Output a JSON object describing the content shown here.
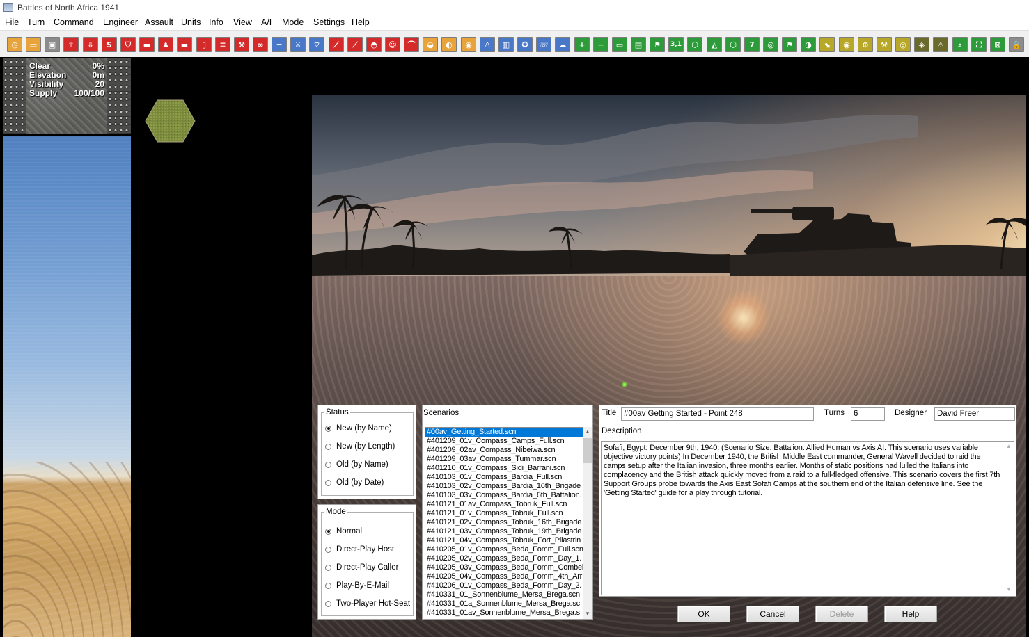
{
  "window": {
    "title": "Battles of North Africa 1941"
  },
  "menu": [
    "File",
    "Turn",
    "Command",
    "Engineer",
    "Assault",
    "Units",
    "Info",
    "View",
    "A/I",
    "Mode",
    "Settings",
    "Help"
  ],
  "toolbar": {
    "buttons": [
      {
        "icon": "clock-icon",
        "color": "#e8a33a",
        "glyph": "◷"
      },
      {
        "icon": "screen-icon",
        "color": "#e8a33a",
        "glyph": "▭"
      },
      {
        "icon": "save-disk-icon",
        "color": "#8c8c8c",
        "glyph": "▣"
      },
      {
        "icon": "upload-icon",
        "color": "#d42a2a",
        "glyph": "⇧"
      },
      {
        "icon": "download-icon",
        "color": "#d42a2a",
        "glyph": "⇩"
      },
      {
        "icon": "s-icon",
        "color": "#d42a2a",
        "glyph": "S"
      },
      {
        "icon": "shield-icon",
        "color": "#d42a2a",
        "glyph": "⛉"
      },
      {
        "icon": "tank-icon",
        "color": "#d42a2a",
        "glyph": "▬"
      },
      {
        "icon": "infantry-icon",
        "color": "#d42a2a",
        "glyph": "♟"
      },
      {
        "icon": "truck-icon",
        "color": "#d42a2a",
        "glyph": "▬"
      },
      {
        "icon": "door-icon",
        "color": "#d42a2a",
        "glyph": "▯"
      },
      {
        "icon": "list-icon",
        "color": "#d42a2a",
        "glyph": "≡"
      },
      {
        "icon": "wrench-icon",
        "color": "#d42a2a",
        "glyph": "⚒"
      },
      {
        "icon": "binoculars-icon",
        "color": "#d42a2a",
        "glyph": "∞"
      },
      {
        "icon": "rifle-icon",
        "color": "#4a78c8",
        "glyph": "━"
      },
      {
        "icon": "crossed-swords-icon",
        "color": "#4a78c8",
        "glyph": "⚔"
      },
      {
        "icon": "signal-icon",
        "color": "#4a78c8",
        "glyph": "⌔"
      },
      {
        "icon": "artillery-icon",
        "color": "#d42a2a",
        "glyph": "⟋"
      },
      {
        "icon": "cannon-icon",
        "color": "#d42a2a",
        "glyph": "⟋"
      },
      {
        "icon": "helmet-icon",
        "color": "#d42a2a",
        "glyph": "◓"
      },
      {
        "icon": "face-icon",
        "color": "#d42a2a",
        "glyph": "☺"
      },
      {
        "icon": "bridge-icon",
        "color": "#d42a2a",
        "glyph": "⌒"
      },
      {
        "icon": "gauge-icon",
        "color": "#e8a33a",
        "glyph": "◒"
      },
      {
        "icon": "mine-icon",
        "color": "#e8a33a",
        "glyph": "◐"
      },
      {
        "icon": "ration-icon",
        "color": "#e8a33a",
        "glyph": "◉"
      },
      {
        "icon": "soldier-icon",
        "color": "#4a78c8",
        "glyph": "♙"
      },
      {
        "icon": "book-icon",
        "color": "#4a78c8",
        "glyph": "▥"
      },
      {
        "icon": "medal-icon",
        "color": "#4a78c8",
        "glyph": "✪"
      },
      {
        "icon": "phone-icon",
        "color": "#4a78c8",
        "glyph": "☏"
      },
      {
        "icon": "cloud-icon",
        "color": "#4a78c8",
        "glyph": "☁"
      },
      {
        "icon": "zoom-in-plus-icon",
        "color": "#2e9b3a",
        "glyph": "+"
      },
      {
        "icon": "zoom-out-minus-icon",
        "color": "#2e9b3a",
        "glyph": "−"
      },
      {
        "icon": "monitor-icon",
        "color": "#2e9b3a",
        "glyph": "▭"
      },
      {
        "icon": "map-icon",
        "color": "#2e9b3a",
        "glyph": "▤"
      },
      {
        "icon": "signpost-icon",
        "color": "#2e9b3a",
        "glyph": "⚑"
      },
      {
        "icon": "coordinates-icon",
        "color": "#2e9b3a",
        "glyph": "3,1"
      },
      {
        "icon": "hex-icon",
        "color": "#2e9b3a",
        "glyph": "⬡"
      },
      {
        "icon": "terrain-icon",
        "color": "#2e9b3a",
        "glyph": "◭"
      },
      {
        "icon": "hex-outline-icon",
        "color": "#2e9b3a",
        "glyph": "⬡"
      },
      {
        "icon": "number-seven-icon",
        "color": "#2e9b3a",
        "glyph": "7"
      },
      {
        "icon": "target-icon",
        "color": "#2e9b3a",
        "glyph": "◎"
      },
      {
        "icon": "flag-icon",
        "color": "#2e9b3a",
        "glyph": "⚑"
      },
      {
        "icon": "contrast-icon",
        "color": "#2e9b3a",
        "glyph": "◑"
      },
      {
        "icon": "move-path-icon",
        "color": "#b8a82a",
        "glyph": "⬊"
      },
      {
        "icon": "objective-icon",
        "color": "#b8a82a",
        "glyph": "◉"
      },
      {
        "icon": "crosshair-icon",
        "color": "#b8a82a",
        "glyph": "⊕"
      },
      {
        "icon": "tools-icon",
        "color": "#b8a82a",
        "glyph": "⚒"
      },
      {
        "icon": "ring-icon",
        "color": "#b8a82a",
        "glyph": "◎"
      },
      {
        "icon": "layers-icon",
        "color": "#6a6a2a",
        "glyph": "◈"
      },
      {
        "icon": "warning-icon",
        "color": "#6a6a2a",
        "glyph": "⚠"
      },
      {
        "icon": "magnifier-icon",
        "color": "#2e9b3a",
        "glyph": "⌕"
      },
      {
        "icon": "fullscreen-icon",
        "color": "#2e9b3a",
        "glyph": "⛶"
      },
      {
        "icon": "close-box-icon",
        "color": "#2e9b3a",
        "glyph": "⊠"
      },
      {
        "icon": "lock-icon",
        "color": "#8c8c8c",
        "glyph": "🔒"
      }
    ]
  },
  "terrain_info": {
    "rows": [
      {
        "label": "Clear",
        "value": "0%"
      },
      {
        "label": "Elevation",
        "value": "0m"
      },
      {
        "label": "Visibility",
        "value": "20"
      },
      {
        "label": "Supply",
        "value": "100/100"
      }
    ]
  },
  "status_group": {
    "title": "Status",
    "options": [
      {
        "label": "New (by Name)",
        "checked": true
      },
      {
        "label": "New (by Length)",
        "checked": false
      },
      {
        "label": "Old (by Name)",
        "checked": false
      },
      {
        "label": "Old (by Date)",
        "checked": false
      }
    ]
  },
  "mode_group": {
    "title": "Mode",
    "options": [
      {
        "label": "Normal",
        "checked": true
      },
      {
        "label": "Direct-Play Host",
        "checked": false
      },
      {
        "label": "Direct-Play Caller",
        "checked": false
      },
      {
        "label": "Play-By-E-Mail",
        "checked": false
      },
      {
        "label": "Two-Player Hot-Seat",
        "checked": false
      }
    ]
  },
  "scenarios": {
    "label": "Scenarios",
    "items": [
      "#00av_Getting_Started.scn",
      "#401209_01v_Compass_Camps_Full.scn",
      "#401209_02av_Compass_Nibeiwa.scn",
      "#401209_03av_Compass_Tummar.scn",
      "#401210_01v_Compass_Sidi_Barrani.scn",
      "#410103_01v_Compass_Bardia_Full.scn",
      "#410103_02v_Compass_Bardia_16th_Brigade",
      "#410103_03v_Compass_Bardia_6th_Battalion.",
      "#410121_01av_Compass_Tobruk_Full.scn",
      "#410121_01v_Compass_Tobruk_Full.scn",
      "#410121_02v_Compass_Tobruk_16th_Brigade",
      "#410121_03v_Compass_Tobruk_19th_Brigade",
      "#410121_04v_Compass_Tobruk_Fort_Pilastrin",
      "#410205_01v_Compass_Beda_Fomm_Full.scn",
      "#410205_02v_Compass_Beda_Fomm_Day_1.",
      "#410205_03v_Compass_Beda_Fomm_Combel",
      "#410205_04v_Compass_Beda_Fomm_4th_Arr",
      "#410206_01v_Compass_Beda_Fomm_Day_2.",
      "#410331_01_Sonnenblume_Mersa_Brega.scn",
      "#410331_01a_Sonnenblume_Mersa_Brega.sc",
      "#410331_01av_Sonnenblume_Mersa_Brega.s"
    ],
    "selected_index": 0
  },
  "details": {
    "title_label": "Title",
    "title_value": "#00av Getting Started - Point 248",
    "turns_label": "Turns",
    "turns_value": "6",
    "designer_label": "Designer",
    "designer_value": "David Freer",
    "description_label": "Description",
    "description_text": "Sofafi, Egypt: December 9th, 1940. (Scenario Size: Battalion. Allied Human vs Axis AI. This scenario uses variable objective victory points) In December 1940, the British Middle East commander, General Wavell decided to raid the camps setup after the Italian invasion, three months earlier. Months of static positions had lulled the Italians into complacency and the British attack quickly moved from a raid to a full-fledged offensive. This scenario covers the first 7th Support Groups probe towards the Axis East Sofafi Camps at the southern end of the Italian defensive line. See the 'Getting Started' guide for a play through tutorial."
  },
  "buttons": {
    "ok": "OK",
    "cancel": "Cancel",
    "delete": "Delete",
    "help": "Help"
  }
}
